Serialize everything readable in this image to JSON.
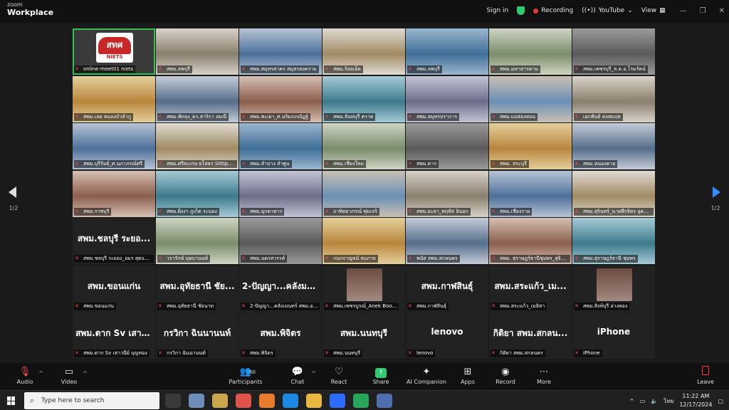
{
  "titlebar": {
    "brand_small": "zoom",
    "brand_large": "Workplace",
    "sign_in": "Sign in",
    "recording": "Recording",
    "youtube": "YouTube",
    "view": "View"
  },
  "pager": {
    "left": "1/2",
    "right": "1/2"
  },
  "tiles": [
    "online-meet01 niets",
    "สพม.ลพบุรี",
    "สพม.สมุทรสาคร สมุทรสงคราม",
    "สพม.ร้อยเอ็ด",
    "สพม.ลพบุรี",
    "สพม.มหาสารคาม",
    "สพม.เพชรบุรี_ส.ต.อ.โรมรัตน์",
    "สพม.เลย หนองบัวลำภู",
    "สพม.พัทลุง_ดร.สาริกา ลมณี",
    "สพม.พะเยา_ศ.นริมภภณัฏฐ์",
    "สพม.จันทบุรี ตราด",
    "สพม.สมุทรปราการ",
    "สพม.แม่ฮ่องสอน",
    "เอกพันธ์ คงสมฤท",
    "สพม.บุรีรัมย์_ศ.นภาภรณ์ศรี",
    "สพม.ศรีสะเกษ ยโสธร Sittipo...",
    "สพม.ลำปาง ลำพูน",
    "สพม.เชียงใหม่",
    "สพม.ตาก",
    "สพม. สระบุรี",
    "สพม.หนองคาย",
    "สพม.ราชบุรี",
    "สพม.ฝั่งงา ภูเก็ต ระนอง",
    "สพม.มุกดาหาร",
    "อาทิตยาภรณ์ พุ่มเจริ",
    "สพม.ยะลา_พฤหัส อินอก",
    "สพม.เชียงราย",
    "สพม.สุรินทร์_นายพีรจิตร อุดม...",
    "สพม.ชลบุรี ระยอง_อมร สุดแส...",
    "วรารักษ์ บุษบานนท์",
    "สพม.นครสวรรค์",
    "กนกกาญจน์ ลบภาย",
    "พนัส สพม.สกลนคร",
    "สพม. สุราษฎร์ธานีชุมพร_สุจินดา...",
    "สพม.สุราษฎร์ธานี ชุมพร",
    "สพม.ขอนแก่น",
    "สพม.อุทัยธานี ชัยนาท",
    "2-ปัญญา...คลังเมนทร์ สพม.อ...",
    "สพม.เพชรบูรณ์_Anek Boo...",
    "สพม.กาฬสินธุ์",
    "สพม.สระแก้ว_เมธิสา",
    "สพม.สิงห์บุรี อ่างทอง",
    "สพม.ตาก Sv เสาวนีย์ บุญทอง",
    "กรวิกา ฉินนานนท์",
    "สพม.พิจิตร",
    "สพม.นนทบุรี",
    "lenovo",
    "กิติยา สพม.สกลนคร",
    "iPhone"
  ],
  "big_names": {
    "28": "สพม.ชลบุรี ระยอ...",
    "35": "สพม.ขอนแก่น",
    "36": "สพม.อุทัยธานี ชัย...",
    "37": "2-ปัญญา...คลังมน...",
    "39": "สพม.กาฬสินธุ์",
    "40": "สพม.สระแก้ว_เม...",
    "42": "สพม.ตาก Sv เสาว...",
    "43": "กรวิกา ฉินนานนท์",
    "44": "สพม.พิจิตร",
    "45": "สพม.นนทบุรี",
    "46": "lenovo",
    "47": "กิติยา สพม.สกลน...",
    "48": "iPhone"
  },
  "logo": {
    "thai": "สทศ",
    "latin": "NIETS"
  },
  "toolbar": {
    "audio": "Audio",
    "video": "Video",
    "participants": "Participants",
    "participants_count": "80",
    "chat": "Chat",
    "react": "React",
    "share": "Share",
    "ai_companion": "AI Companion",
    "apps": "Apps",
    "record": "Record",
    "more": "More",
    "leave": "Leave"
  },
  "taskbar": {
    "search_placeholder": "Type here to search",
    "lang": "ไทย",
    "time": "11:22 AM",
    "date": "12/17/2024"
  },
  "colors": {
    "active_border": "#31c24f",
    "accent": "#2e8cff",
    "mute": "#ff4c4c"
  }
}
